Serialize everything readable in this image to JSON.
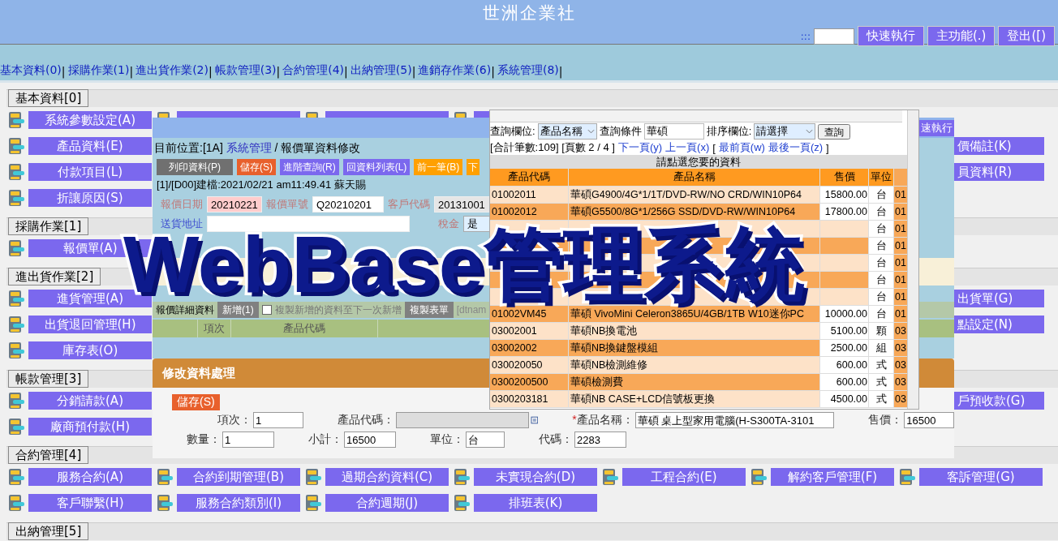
{
  "header": {
    "title": "世洲企業社",
    "quick_prefix": ":::",
    "buttons": [
      "快速執行",
      "主功能(.)",
      "登出([)"
    ]
  },
  "nav": {
    "separator": "|",
    "items": [
      "基本資料(0)",
      "採購作業(1)",
      "進出貨作業(2)",
      "帳款管理(3)",
      "合約管理(4)",
      "出納管理(5)",
      "進銷存作業(6)",
      "系統管理(8)"
    ]
  },
  "sections": [
    {
      "title": "基本資料[0]",
      "rows": [
        [
          {
            "kind": "menu",
            "label": "系統參數設定(A)"
          },
          {
            "kind": "covered"
          },
          {
            "kind": "covered"
          },
          {
            "kind": "covered"
          },
          {
            "kind": "covered"
          }
        ],
        [
          {
            "kind": "menu",
            "label": "產品資料(E)"
          },
          {
            "kind": "covered"
          },
          {
            "kind": "covered"
          },
          {
            "kind": "covered"
          },
          {
            "kind": "covered"
          },
          {
            "kind": "covered"
          },
          {
            "kind": "clipped",
            "label": "價備註(K)"
          }
        ],
        [
          {
            "kind": "menu",
            "label": "付款項目(L)"
          },
          {
            "kind": "covered"
          },
          {
            "kind": "covered"
          },
          {
            "kind": "covered"
          },
          {
            "kind": "covered"
          },
          {
            "kind": "covered"
          },
          {
            "kind": "clipped",
            "label": "員資料(R)"
          }
        ],
        [
          {
            "kind": "menu",
            "label": "折讓原因(S)"
          }
        ]
      ]
    },
    {
      "title": "採購作業[1]",
      "rows": [
        [
          {
            "kind": "menu",
            "label": "報價單(A)"
          }
        ]
      ]
    },
    {
      "title": "進出貨作業[2]",
      "rows": [
        [
          {
            "kind": "menu",
            "label": "進貨管理(A)"
          },
          {
            "kind": "covered"
          },
          {
            "kind": "covered"
          },
          {
            "kind": "covered"
          },
          {
            "kind": "covered"
          },
          {
            "kind": "covered"
          },
          {
            "kind": "clipped",
            "label": "出貨單(G)"
          }
        ],
        [
          {
            "kind": "menu",
            "label": "出貨退回管理(H)"
          },
          {
            "kind": "covered"
          },
          {
            "kind": "covered"
          },
          {
            "kind": "covered"
          },
          {
            "kind": "covered"
          },
          {
            "kind": "covered"
          },
          {
            "kind": "clipped",
            "label": "點設定(N)"
          }
        ],
        [
          {
            "kind": "menu",
            "label": "庫存表(O)"
          }
        ]
      ]
    },
    {
      "title": "帳款管理[3]",
      "rows": [
        [
          {
            "kind": "menu",
            "label": "分銷請款(A)"
          },
          {
            "kind": "covered"
          },
          {
            "kind": "covered"
          },
          {
            "kind": "covered"
          },
          {
            "kind": "covered"
          },
          {
            "kind": "covered"
          },
          {
            "kind": "clipped",
            "label": "戶預收款(G)"
          }
        ],
        [
          {
            "kind": "menu",
            "label": "廠商預付款(H)"
          }
        ]
      ]
    },
    {
      "title": "合約管理[4]",
      "rows": [
        [
          {
            "kind": "menu",
            "label": "服務合約(A)"
          },
          {
            "kind": "menu",
            "label": "合約到期管理(B)"
          },
          {
            "kind": "menu",
            "label": "過期合約資料(C)"
          },
          {
            "kind": "menu",
            "label": "未實現合約(D)"
          },
          {
            "kind": "menu",
            "label": "工程合約(E)"
          },
          {
            "kind": "menu",
            "label": "解約客戶管理(F)"
          },
          {
            "kind": "menu",
            "label": "客訴管理(G)"
          }
        ],
        [
          {
            "kind": "menu",
            "label": "客戶聯繫(H)"
          },
          {
            "kind": "menu",
            "label": "服務合約類別(I)"
          },
          {
            "kind": "menu",
            "label": "合約週期(J)"
          },
          {
            "kind": "menu",
            "label": "排班表(K)"
          }
        ]
      ]
    },
    {
      "title": "出納管理[5]"
    }
  ],
  "quote_window": {
    "corner_button": "速執行",
    "breadcrumb_prefix": "目前位置:[1A]",
    "breadcrumb_link": "系統管理",
    "breadcrumb_rest": "/ 報價單資料修改",
    "toolbar": [
      {
        "label": "列印資料(P)",
        "kind": "print"
      },
      {
        "label": "儲存(S)",
        "kind": "save"
      },
      {
        "label": "進階查詢(R)",
        "kind": "nav"
      },
      {
        "label": "回資料列表(L)",
        "kind": "nav"
      },
      {
        "label": "前一筆(B)",
        "kind": "step"
      },
      {
        "label": "下",
        "kind": "step"
      }
    ],
    "created": "[1]/[D00]建檔:2021/02/21 am11:49.41  蘇天賜",
    "fields": [
      {
        "label": "報價日期",
        "value": "20210221",
        "kind": "date"
      },
      {
        "label": "報價單號",
        "value": "Q20210201",
        "kind": "text"
      },
      {
        "label": "客戶代碼",
        "value": "20131001",
        "kind": "readonly"
      }
    ],
    "address_label": "送貨地址",
    "tax_label": "稅金",
    "tax_value": "是",
    "detail": {
      "title": "報價詳細資料",
      "add_button": "新增(1)",
      "copy_checkbox": {
        "label": "複製新增的資料至下一次新增",
        "checked": false
      },
      "copy_button": "複製表單",
      "dtname": "[dtnam",
      "columns": [
        "項次",
        "產品代碼"
      ]
    }
  },
  "edit_dialog": {
    "title": "修改資料處理",
    "save_button": "儲存(S)",
    "lines": [
      {
        "fields": [
          {
            "label": "項次：",
            "value": "1",
            "kind": "text"
          },
          {
            "label": "產品代碼：",
            "kind": "lookup"
          },
          {
            "label": "產品名稱：",
            "mark": "*",
            "value": "華碩 桌上型家用電腦(H-S300TA-3101",
            "kind": "wide"
          },
          {
            "label": "售價：",
            "value": "16500",
            "kind": "text"
          }
        ]
      },
      {
        "fields": [
          {
            "label": "數量：",
            "value": "1",
            "kind": "text"
          },
          {
            "label": "小計：",
            "value": "16500",
            "kind": "text"
          },
          {
            "label": "單位：",
            "value": "台",
            "kind": "short"
          },
          {
            "label": "代碼：",
            "value": "2283",
            "kind": "text"
          }
        ]
      }
    ]
  },
  "lookup_popup": {
    "query_label": "查詢欄位:",
    "query_field": "產品名稱",
    "condition_label": "查詢條件",
    "condition_value": "華碩",
    "sort_label": "排序欄位:",
    "sort_value": "請選擇",
    "search_button": "查詢",
    "total": "[合計筆數:109] [頁數 2 / 4 ]",
    "links": [
      "下一頁(y)",
      "上一頁(x)"
    ],
    "bracket_open": "[",
    "links2": [
      "最前頁(w)",
      "最後一頁(z)"
    ],
    "bracket_close": "]",
    "caption": "請點選您要的資料",
    "columns": [
      "產品代碼",
      "產品名稱",
      "售價",
      "單位"
    ],
    "rows": [
      {
        "code": "01002011",
        "name": "華碩G4900/4G*1/1T/DVD-RW/NO CRD/WIN10P64",
        "price": "15800.00",
        "unit": "台",
        "group": "01"
      },
      {
        "code": "01002012",
        "name": "華碩G5500/8G*1/256G SSD/DVD-RW/WIN10P64",
        "price": "17800.00",
        "unit": "台",
        "group": "01"
      },
      {
        "unit": "台",
        "group": "01"
      },
      {
        "unit": "台",
        "group": "01"
      },
      {
        "unit": "台",
        "group": "01"
      },
      {
        "unit": "台",
        "group": "01"
      },
      {
        "unit": "台",
        "group": "01"
      },
      {
        "code": "01002VM45",
        "name": "華碩 VivoMini Celeron3865U/4GB/1TB W10迷你PC",
        "price": "10000.00",
        "unit": "台",
        "group": "01"
      },
      {
        "code": "03002001",
        "name": "華碩NB換電池",
        "price": "5100.00",
        "unit": "顆",
        "group": "03"
      },
      {
        "code": "03002002",
        "name": "華碩NB換鍵盤模組",
        "price": "2500.00",
        "unit": "組",
        "group": "03"
      },
      {
        "code": "030020050",
        "name": "華碩NB檢測維修",
        "price": "600.00",
        "unit": "式",
        "group": "03"
      },
      {
        "code": "0300200500",
        "name": "華碩檢測費",
        "price": "600.00",
        "unit": "式",
        "group": "03"
      },
      {
        "code": "0300203181",
        "name": "華碩NB CASE+LCD信號板更換",
        "price": "4500.00",
        "unit": "式",
        "group": "03"
      }
    ]
  },
  "overlay_title": "WebBase管理系統"
}
